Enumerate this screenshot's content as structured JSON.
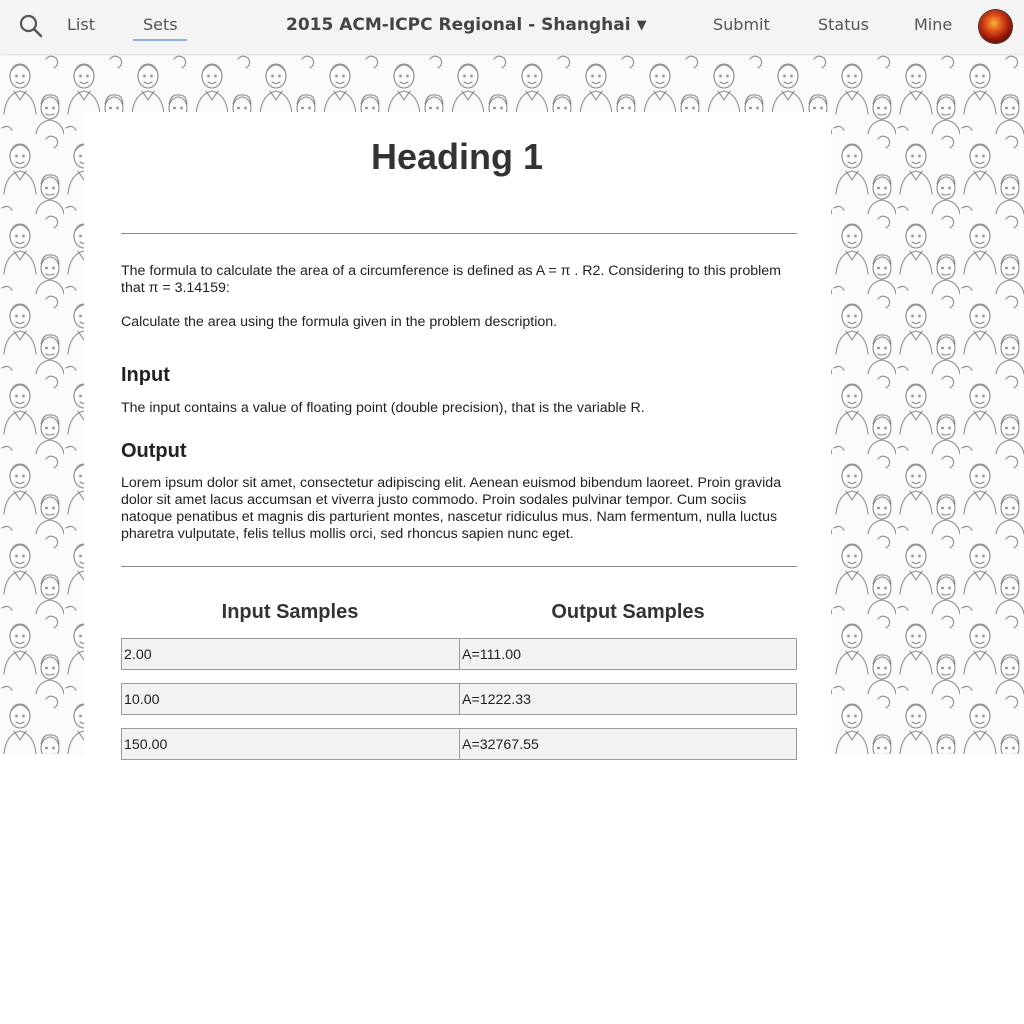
{
  "nav": {
    "list_label": "List",
    "sets_label": "Sets",
    "contest_title": "2015 ACM-ICPC Regional - Shanghai",
    "contest_caret": "▼",
    "submit_label": "Submit",
    "status_label": "Status",
    "mine_label": "Mine",
    "icons": [
      "search-icon",
      "user-avatar"
    ]
  },
  "problem": {
    "title": "Heading 1",
    "description_1": "The formula to calculate the area of a circumference is defined as A = π . R2. Considering to this problem that π = 3.14159:",
    "description_2": "Calculate the area using the formula given in the problem description.",
    "input_title": "Input",
    "input_text": "The input contains a value of floating point (double precision), that is the variable R.",
    "output_title": "Output",
    "output_text": "Lorem ipsum dolor sit amet, consectetur adipiscing elit. Aenean euismod bibendum laoreet. Proin gravida dolor sit amet lacus accumsan et viverra justo commodo. Proin sodales pulvinar tempor. Cum sociis natoque penatibus et magnis dis parturient montes, nascetur ridiculus mus. Nam fermentum, nulla luctus pharetra vulputate, felis tellus mollis orci, sed rhoncus sapien nunc eget."
  },
  "samples": {
    "input_header": "Input Samples",
    "output_header": "Output Samples",
    "rows": [
      {
        "input": "2.00",
        "output": "A=111.00"
      },
      {
        "input": "10.00",
        "output": "A=1222.33"
      },
      {
        "input": "150.00",
        "output": "A=32767.55"
      }
    ]
  },
  "colors": {
    "navbar_bg": "#f4f4f4",
    "active_underline": "#8fb0e0",
    "card_bg": "#ffffff",
    "cell_bg": "#f2f2f2"
  }
}
